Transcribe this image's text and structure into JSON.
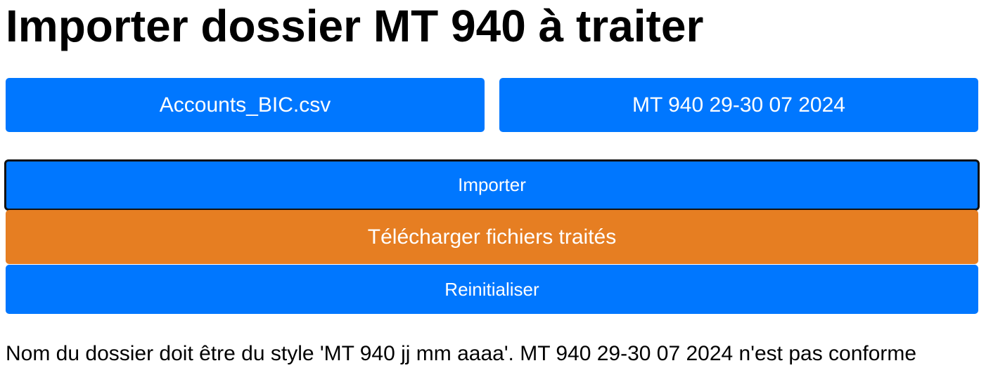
{
  "page": {
    "title": "Importer dossier MT 940 à traiter"
  },
  "inputs": {
    "accounts_file_label": "Accounts_BIC.csv",
    "folder_label": "MT 940 29-30 07 2024"
  },
  "actions": {
    "import_label": "Importer",
    "download_label": "Télécharger fichiers traités",
    "reset_label": "Reinitialiser"
  },
  "status": {
    "message": "Nom du dossier doit être du style 'MT 940 jj mm aaaa'. MT 940 29-30 07 2024 n'est pas conforme"
  },
  "colors": {
    "primary": "#0077ff",
    "download": "#e67e22",
    "focus_border": "#111111",
    "text": "#000000"
  }
}
